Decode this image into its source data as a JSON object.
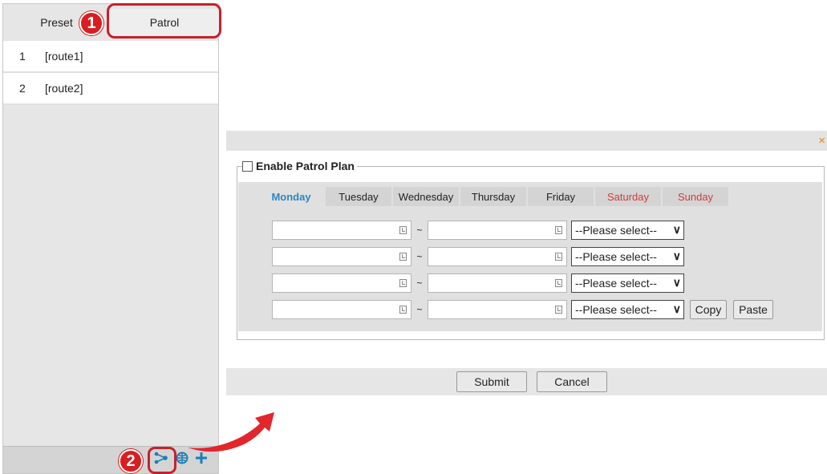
{
  "left_panel": {
    "tabs": [
      {
        "label": "Preset"
      },
      {
        "label": "Patrol"
      }
    ],
    "routes": [
      {
        "num": "1",
        "name": "[route1]"
      },
      {
        "num": "2",
        "name": "[route2]"
      }
    ]
  },
  "callouts": [
    "1",
    "2"
  ],
  "dialog": {
    "close_icon": "×",
    "enable_label": "Enable Patrol Plan",
    "days": [
      {
        "label": "Monday"
      },
      {
        "label": "Tuesday"
      },
      {
        "label": "Wednesday"
      },
      {
        "label": "Thursday"
      },
      {
        "label": "Friday"
      },
      {
        "label": "Saturday"
      },
      {
        "label": "Sunday"
      }
    ],
    "separator": "~",
    "select_placeholder": "--Please select--",
    "copy_label": "Copy",
    "paste_label": "Paste",
    "submit_label": "Submit",
    "cancel_label": "Cancel"
  },
  "icons": [
    "patrol-route-icon",
    "globe-icon",
    "plus-icon"
  ],
  "colors": {
    "accent": "#2f86c3",
    "weekend": "#d03c3c",
    "callout": "#d81e22",
    "close": "#e4841e"
  }
}
